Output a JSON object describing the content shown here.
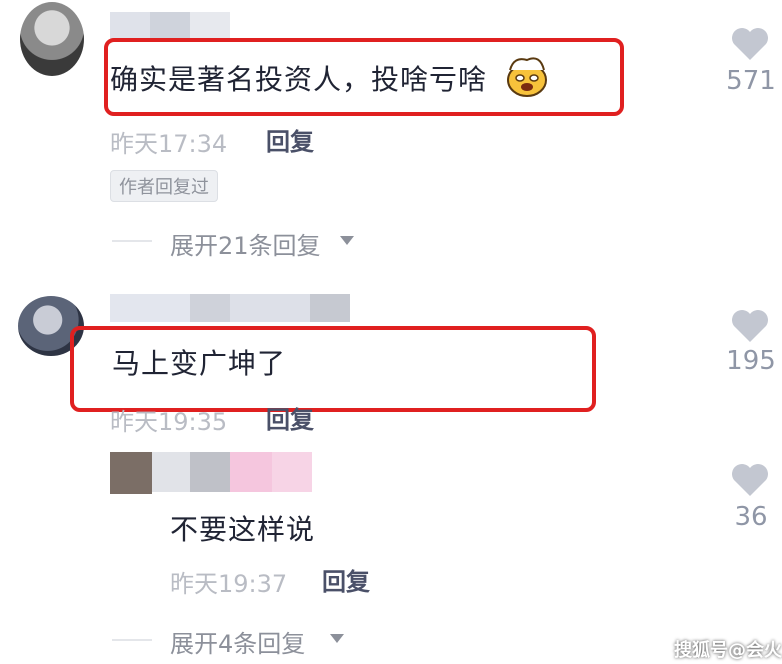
{
  "comments": [
    {
      "text": "确实是著名投资人，投啥亏啥",
      "emoji_icon": "exploding-head-emoji",
      "time": "昨天17:34",
      "reply_label": "回复",
      "badge": "作者回复过",
      "likes": "571",
      "expand_label": "展开21条回复"
    },
    {
      "text": "马上变广坤了",
      "time": "昨天19:35",
      "reply_label": "回复",
      "likes": "195"
    }
  ],
  "replies": [
    {
      "text": "不要这样说",
      "time": "昨天19:37",
      "reply_label": "回复",
      "likes": "36",
      "expand_label": "展开4条回复"
    }
  ],
  "watermark": "搜狐号@会火",
  "colors": {
    "highlight": "#e02020",
    "text": "#202434",
    "meta": "#b9bcc4",
    "like": "#8f96a6"
  }
}
